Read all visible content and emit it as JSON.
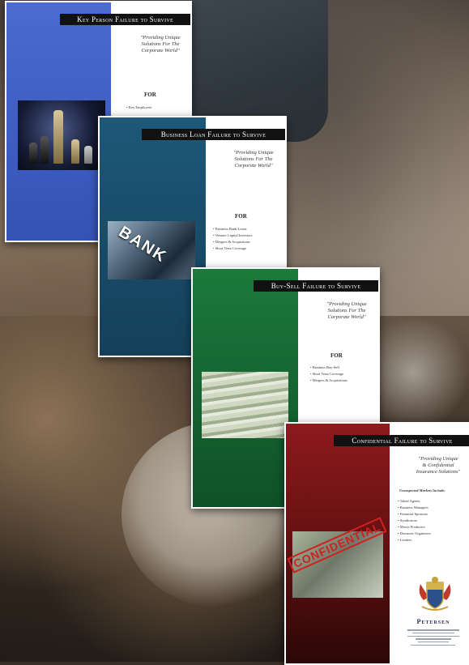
{
  "brochures": [
    {
      "title": "Key Person Failure to Survive",
      "tagline": "\"Providing Unique\nSolutions For The\nCorporate World\"",
      "for_label": "FOR",
      "items": [
        "Key Employees"
      ],
      "color": "#3f5fc4"
    },
    {
      "title": "Business Loan Failure to Survive",
      "tagline": "\"Providing Unique\nSolutions For The\nCorporate World\"",
      "for_label": "FOR",
      "items": [
        "Business Bank Loans",
        "Venture Capital Investors",
        "Mergers & Acquisitions",
        "Short Term Coverage"
      ],
      "photo_text": "BANK",
      "color": "#1a4d6a"
    },
    {
      "title": "Buy-Sell Failure to Survive",
      "tagline": "\"Providing Unique\nSolutions For The\nCorporate World\"",
      "for_label": "FOR",
      "items": [
        "Business Buy-Sell",
        "Short Term Coverage",
        "Mergers & Acquisitions"
      ],
      "color": "#15683a"
    },
    {
      "title": "Confidential Failure to Survive",
      "tagline": "\"Providing Unique\n& Confidential\nInsurance Solutions\"",
      "subhead": "Unsuspected Markets Include:",
      "items": [
        "Talent Agents",
        "Business Managers",
        "Financial Sponsors",
        "Syndicators",
        "Movie Producers",
        "Domestic Organizers",
        "Lenders"
      ],
      "stamp": "CONFIDENTIAL",
      "firm": "Petersen",
      "color": "#7d1718"
    }
  ]
}
